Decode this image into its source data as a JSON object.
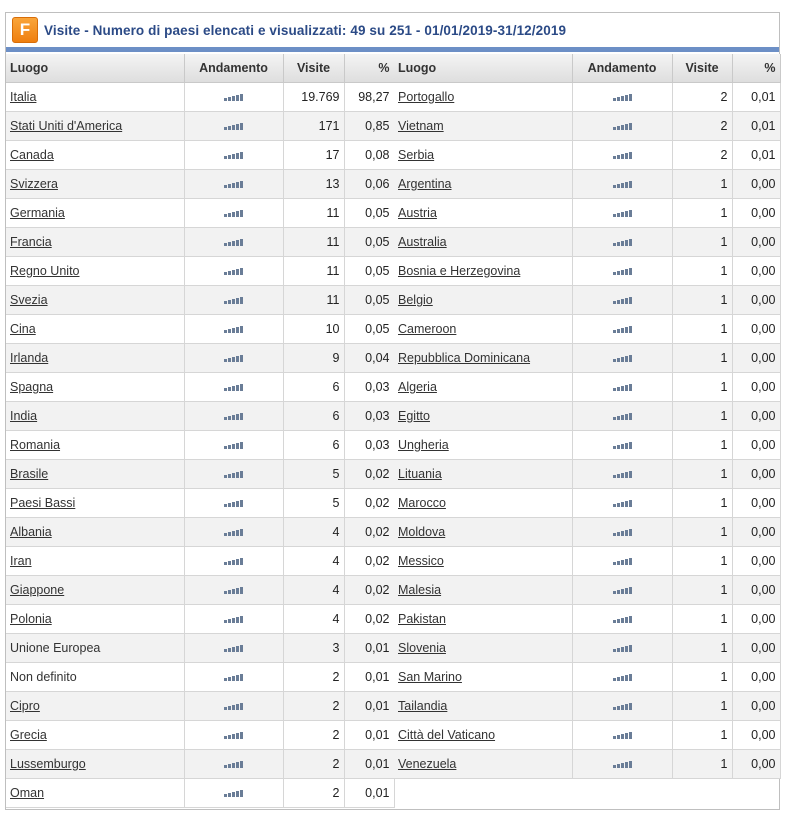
{
  "header": {
    "logo_letter": "F",
    "title": "Visite - Numero di paesi elencati e visualizzati: 49 su 251 - 01/01/2019-31/12/2019"
  },
  "columns": {
    "place": "Luogo",
    "trend": "Andamento",
    "visits": "Visite",
    "pct": "%"
  },
  "trend_icon": "bar-chart-icon",
  "left_rows": [
    {
      "name": "Italia",
      "visits": "19.769",
      "pct": "98,27",
      "link": true
    },
    {
      "name": "Stati Uniti d'America",
      "visits": "171",
      "pct": "0,85",
      "link": true
    },
    {
      "name": "Canada",
      "visits": "17",
      "pct": "0,08",
      "link": true
    },
    {
      "name": "Svizzera",
      "visits": "13",
      "pct": "0,06",
      "link": true
    },
    {
      "name": "Germania",
      "visits": "11",
      "pct": "0,05",
      "link": true
    },
    {
      "name": "Francia",
      "visits": "11",
      "pct": "0,05",
      "link": true
    },
    {
      "name": "Regno Unito",
      "visits": "11",
      "pct": "0,05",
      "link": true
    },
    {
      "name": "Svezia",
      "visits": "11",
      "pct": "0,05",
      "link": true
    },
    {
      "name": "Cina",
      "visits": "10",
      "pct": "0,05",
      "link": true
    },
    {
      "name": "Irlanda",
      "visits": "9",
      "pct": "0,04",
      "link": true
    },
    {
      "name": "Spagna",
      "visits": "6",
      "pct": "0,03",
      "link": true
    },
    {
      "name": "India",
      "visits": "6",
      "pct": "0,03",
      "link": true
    },
    {
      "name": "Romania",
      "visits": "6",
      "pct": "0,03",
      "link": true
    },
    {
      "name": "Brasile",
      "visits": "5",
      "pct": "0,02",
      "link": true
    },
    {
      "name": "Paesi Bassi",
      "visits": "5",
      "pct": "0,02",
      "link": true
    },
    {
      "name": "Albania",
      "visits": "4",
      "pct": "0,02",
      "link": true
    },
    {
      "name": "Iran",
      "visits": "4",
      "pct": "0,02",
      "link": true
    },
    {
      "name": "Giappone",
      "visits": "4",
      "pct": "0,02",
      "link": true
    },
    {
      "name": "Polonia",
      "visits": "4",
      "pct": "0,02",
      "link": true
    },
    {
      "name": "Unione Europea",
      "visits": "3",
      "pct": "0,01",
      "link": false
    },
    {
      "name": "Non definito",
      "visits": "2",
      "pct": "0,01",
      "link": false
    },
    {
      "name": "Cipro",
      "visits": "2",
      "pct": "0,01",
      "link": true
    },
    {
      "name": "Grecia",
      "visits": "2",
      "pct": "0,01",
      "link": true
    },
    {
      "name": "Lussemburgo",
      "visits": "2",
      "pct": "0,01",
      "link": true
    },
    {
      "name": "Oman",
      "visits": "2",
      "pct": "0,01",
      "link": true
    }
  ],
  "right_rows": [
    {
      "name": "Portogallo",
      "visits": "2",
      "pct": "0,01",
      "link": true
    },
    {
      "name": "Vietnam",
      "visits": "2",
      "pct": "0,01",
      "link": true
    },
    {
      "name": "Serbia",
      "visits": "2",
      "pct": "0,01",
      "link": true
    },
    {
      "name": "Argentina",
      "visits": "1",
      "pct": "0,00",
      "link": true
    },
    {
      "name": "Austria",
      "visits": "1",
      "pct": "0,00",
      "link": true
    },
    {
      "name": "Australia",
      "visits": "1",
      "pct": "0,00",
      "link": true
    },
    {
      "name": "Bosnia e Herzegovina",
      "visits": "1",
      "pct": "0,00",
      "link": true
    },
    {
      "name": "Belgio",
      "visits": "1",
      "pct": "0,00",
      "link": true
    },
    {
      "name": "Cameroon",
      "visits": "1",
      "pct": "0,00",
      "link": true
    },
    {
      "name": "Repubblica Dominicana",
      "visits": "1",
      "pct": "0,00",
      "link": true
    },
    {
      "name": "Algeria",
      "visits": "1",
      "pct": "0,00",
      "link": true
    },
    {
      "name": "Egitto",
      "visits": "1",
      "pct": "0,00",
      "link": true
    },
    {
      "name": "Ungheria",
      "visits": "1",
      "pct": "0,00",
      "link": true
    },
    {
      "name": "Lituania",
      "visits": "1",
      "pct": "0,00",
      "link": true
    },
    {
      "name": "Marocco",
      "visits": "1",
      "pct": "0,00",
      "link": true
    },
    {
      "name": "Moldova",
      "visits": "1",
      "pct": "0,00",
      "link": true
    },
    {
      "name": "Messico",
      "visits": "1",
      "pct": "0,00",
      "link": true
    },
    {
      "name": "Malesia",
      "visits": "1",
      "pct": "0,00",
      "link": true
    },
    {
      "name": "Pakistan",
      "visits": "1",
      "pct": "0,00",
      "link": true
    },
    {
      "name": "Slovenia",
      "visits": "1",
      "pct": "0,00",
      "link": true
    },
    {
      "name": "San Marino",
      "visits": "1",
      "pct": "0,00",
      "link": true
    },
    {
      "name": "Tailandia",
      "visits": "1",
      "pct": "0,00",
      "link": true
    },
    {
      "name": "Città del Vaticano",
      "visits": "1",
      "pct": "0,00",
      "link": true
    },
    {
      "name": "Venezuela",
      "visits": "1",
      "pct": "0,00",
      "link": true
    }
  ]
}
